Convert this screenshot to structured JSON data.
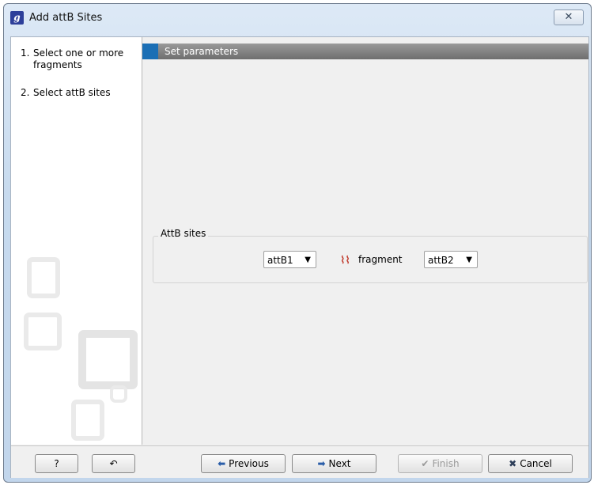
{
  "window": {
    "title": "Add attB Sites",
    "app_icon_glyph": "g",
    "close_glyph": "✕"
  },
  "steps": [
    {
      "num": "1.",
      "label": "Select one or more fragments"
    },
    {
      "num": "2.",
      "label": "Select attB sites"
    }
  ],
  "panel": {
    "header": "Set parameters"
  },
  "group": {
    "label": "AttB sites",
    "left_select": {
      "value": "attB1",
      "arrow": "▼"
    },
    "fragment_icon": "fragment-icon",
    "fragment_label": "fragment",
    "right_select": {
      "value": "attB2",
      "arrow": "▼"
    }
  },
  "buttons": {
    "help": "?",
    "reset_glyph": "↶",
    "previous": "Previous",
    "next": "Next",
    "finish": "Finish",
    "cancel": "Cancel"
  },
  "colors": {
    "accent": "#1b6fb5",
    "fragment_icon": "#c0392b"
  }
}
